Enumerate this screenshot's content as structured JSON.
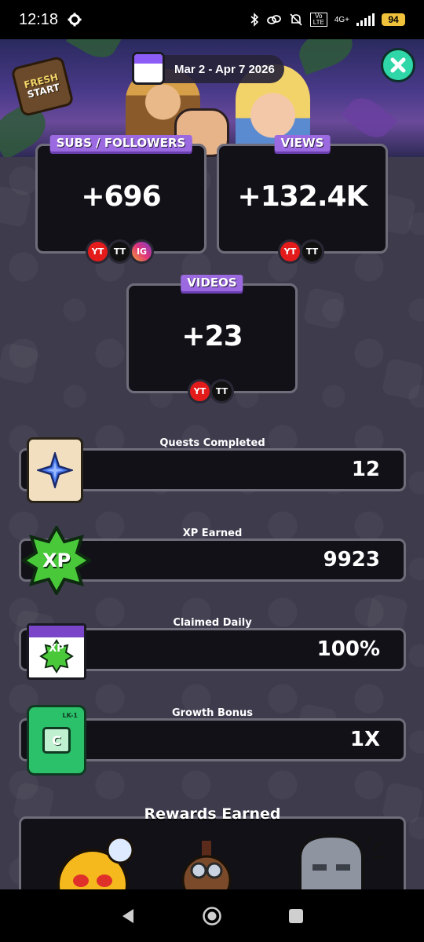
{
  "status_bar": {
    "time": "12:18",
    "network": "4G+",
    "volte": "Vo LTE",
    "battery": "94"
  },
  "banner": {
    "badge_line1": "FRESH",
    "badge_line2": "START",
    "date_range": "Mar 2 - Apr 7 2026"
  },
  "stats": {
    "subs": {
      "label": "SUBS / FOLLOWERS",
      "value": "+696",
      "platforms": [
        "YT",
        "TT",
        "IG"
      ]
    },
    "views": {
      "label": "VIEWS",
      "value": "+132.4K",
      "platforms": [
        "YT",
        "TT"
      ]
    },
    "videos": {
      "label": "VIDEOS",
      "value": "+23",
      "platforms": [
        "YT",
        "TT"
      ]
    }
  },
  "rows": {
    "quests": {
      "label": "Quests Completed",
      "value": "12",
      "icon": "star-scroll-icon"
    },
    "xp": {
      "label": "XP Earned",
      "value": "9923",
      "icon_text": "XP"
    },
    "daily": {
      "label": "Claimed Daily",
      "value": "100%",
      "icon_text": "XP"
    },
    "growth": {
      "label": "Growth Bonus",
      "value": "1X",
      "icon_text": "LK-1",
      "icon_letter": "C"
    }
  },
  "rewards": {
    "title": "Rewards Earned"
  },
  "colors": {
    "background": "#3d3a4c",
    "card": "#121118",
    "tag_purple": "#9b6ae0",
    "close_teal": "#2fd6a8",
    "youtube_red": "#e41b1b",
    "xp_green": "#49c83a"
  }
}
